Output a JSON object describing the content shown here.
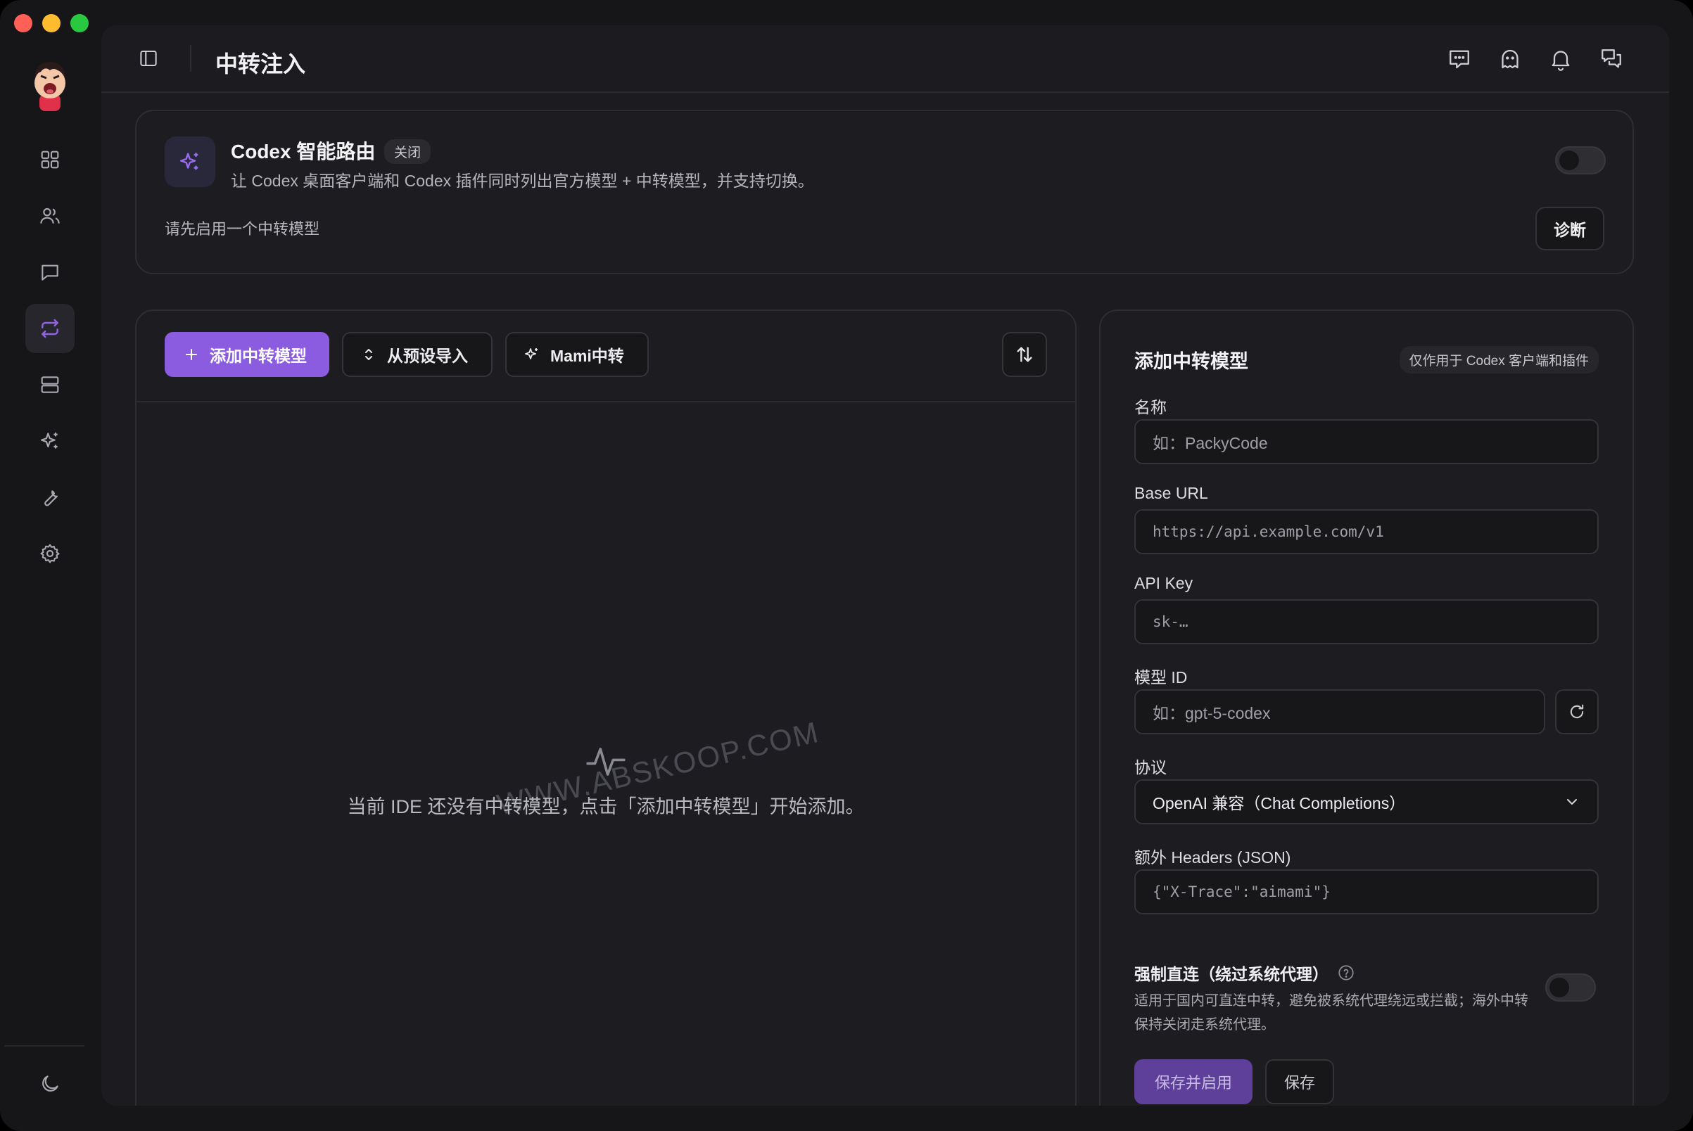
{
  "window": {
    "title": "中转注入"
  },
  "sidebar": {
    "items": [
      {
        "icon": "dashboard-icon"
      },
      {
        "icon": "users-icon"
      },
      {
        "icon": "chat-icon"
      },
      {
        "icon": "relay-icon",
        "active": true
      },
      {
        "icon": "server-icon"
      },
      {
        "icon": "sparkle-icon"
      },
      {
        "icon": "wrench-icon"
      },
      {
        "icon": "gear-icon"
      }
    ],
    "bottom_icon": "moon-icon"
  },
  "topbar_icons": [
    "message-icon",
    "ghost-icon",
    "bell-icon",
    "chats-icon"
  ],
  "router": {
    "title": "Codex 智能路由",
    "badge": "关闭",
    "description": "让 Codex 桌面客户端和 Codex 插件同时列出官方模型 + 中转模型，并支持切换。",
    "hint": "请先启用一个中转模型",
    "diagnose_label": "诊断",
    "enabled": false
  },
  "list": {
    "add_label": "添加中转模型",
    "import_label": "从预设导入",
    "mami_label": "Mami中转",
    "empty_message": "当前 IDE 还没有中转模型，点击「添加中转模型」开始添加。",
    "watermark": "WWW.ABSKOOP.COM"
  },
  "form": {
    "title": "添加中转模型",
    "badge": "仅作用于 Codex 客户端和插件",
    "name_label": "名称",
    "name_placeholder": "如：PackyCode",
    "base_url_label": "Base URL",
    "base_url_placeholder": "https://api.example.com/v1",
    "api_key_label": "API Key",
    "api_key_placeholder": "sk-…",
    "model_id_label": "模型 ID",
    "model_id_placeholder": "如：gpt-5-codex",
    "protocol_label": "协议",
    "protocol_value": "OpenAI 兼容（Chat Completions）",
    "headers_label": "额外 Headers (JSON)",
    "headers_placeholder": "{\"X-Trace\":\"aimami\"}",
    "force_title": "强制直连（绕过系统代理）",
    "force_desc": "适用于国内可直连中转，避免被系统代理绕远或拦截；海外中转保持关闭走系统代理。",
    "force_enabled": false,
    "save_enable_label": "保存并启用",
    "save_label": "保存"
  },
  "colors": {
    "accent": "#8c5ce0",
    "background": "#1c1c20"
  }
}
